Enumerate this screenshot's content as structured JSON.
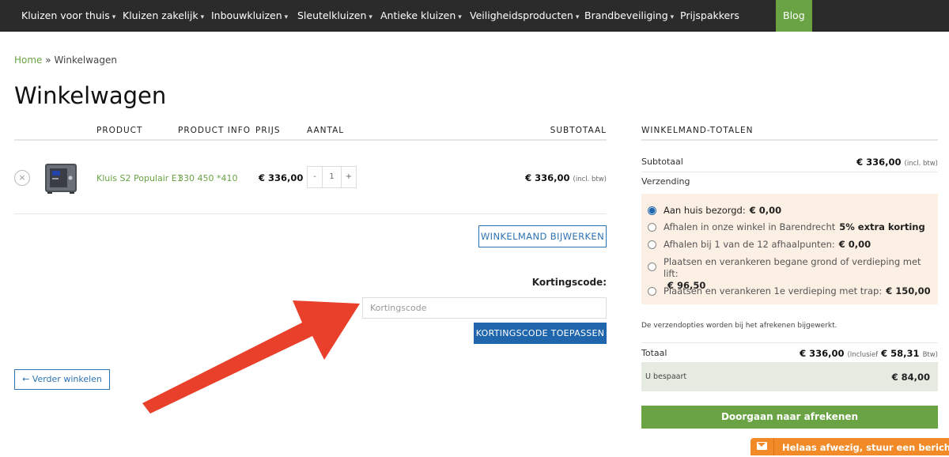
{
  "nav": {
    "items": [
      {
        "label": "Kluizen voor thuis"
      },
      {
        "label": "Kluizen zakelijk"
      },
      {
        "label": "Inbouwkluizen"
      },
      {
        "label": "Sleutelkluizen"
      },
      {
        "label": "Antieke kluizen"
      },
      {
        "label": "Veiligheidsproducten"
      },
      {
        "label": "Brandbeveiliging"
      },
      {
        "label": "Prijspakkers"
      }
    ],
    "blog_label": "Blog",
    "chevron": "▾"
  },
  "breadcrumb": {
    "home": "Home",
    "separator": "»",
    "current": "Winkelwagen"
  },
  "page_title": "Winkelwagen",
  "cart_table": {
    "headers": {
      "product": "PRODUCT",
      "info": "PRODUCT INFO",
      "price": "PRIJS",
      "qty": "AANTAL",
      "subtotal": "SUBTOTAAL"
    },
    "row": {
      "remove_icon": "×",
      "name": "Kluis S2 Populair E1",
      "info": "330 450 *410",
      "price": "€ 336,00",
      "qty": "1",
      "qty_minus": "-",
      "qty_plus": "+",
      "subtotal": "€ 336,00",
      "subtotal_suffix": "(incl. btw)"
    }
  },
  "update_button": "WINKELMAND BIJWERKEN",
  "coupon": {
    "label": "Kortingscode:",
    "placeholder": "Kortingscode",
    "apply_button": "KORTINGSCODE TOEPASSEN"
  },
  "continue_button": "← Verder winkelen",
  "totals": {
    "title": "WINKELMAND-TOTALEN",
    "subtotal_label": "Subtotaal",
    "subtotal_value": "€ 336,00",
    "subtotal_suffix": "(incl. btw)",
    "shipping_label": "Verzending",
    "shipping_options": [
      {
        "label": "Aan huis bezorgd:",
        "price": "€ 0,00",
        "checked": true
      },
      {
        "label": "Afhalen in onze winkel in Barendrecht",
        "price": "5% extra korting",
        "checked": false
      },
      {
        "label": "Afhalen bij 1 van de 12 afhaalpunten:",
        "price": "€ 0,00",
        "checked": false
      },
      {
        "label": "Plaatsen en verankeren begane grond of verdieping met lift:",
        "price": "€ 96,50",
        "checked": false
      },
      {
        "label": "Plaatsen en verankeren 1e verdieping met trap:",
        "price": "€ 150,00",
        "checked": false
      }
    ],
    "shipping_note": "De verzendopties worden bij het afrekenen bijgewerkt.",
    "total_label": "Totaal",
    "total_value": "€ 336,00",
    "total_inclusive": "(Inclusief",
    "total_tax": "€ 58,31",
    "total_tax_suffix": "Btw)",
    "savings_label": "U bespaart",
    "savings_value": "€ 84,00",
    "checkout_button": "Doorgaan naar afrekenen"
  },
  "chat": {
    "label": "Helaas afwezig, stuur een bericht"
  },
  "colors": {
    "accent_green": "#6aa344",
    "accent_blue": "#2066ac",
    "chat_orange": "#f28a28",
    "arrow_red": "#e8402a"
  }
}
